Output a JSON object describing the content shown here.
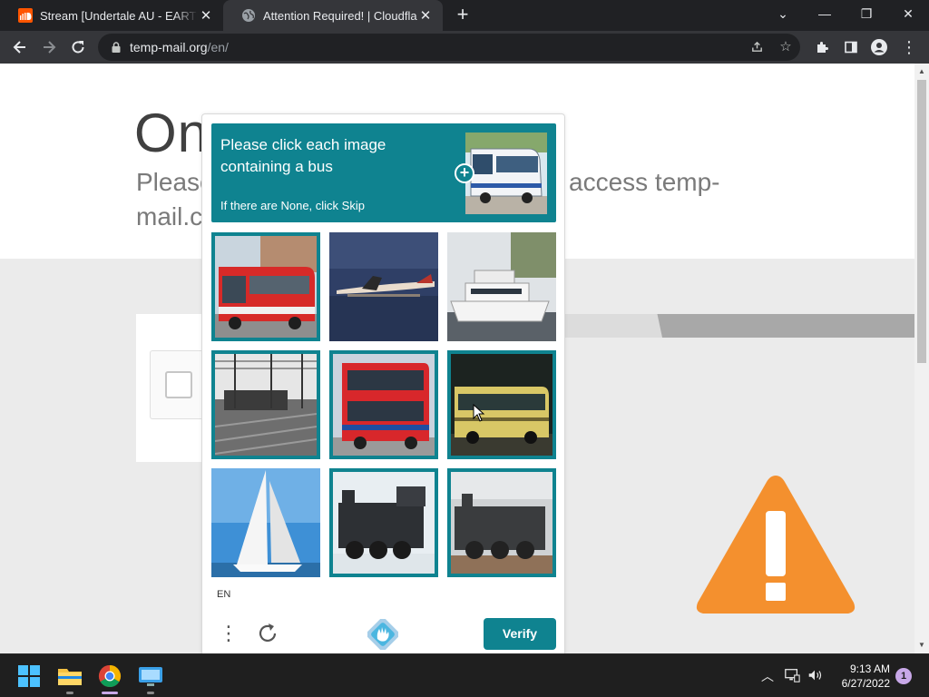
{
  "browser": {
    "tabs": [
      {
        "title": "Stream [Undertale AU - EARTHSE",
        "favicon": "soundcloud-icon",
        "active": false
      },
      {
        "title": "Attention Required! | Cloudflare",
        "favicon": "globe-icon",
        "active": true
      }
    ],
    "new_tab_label": "+",
    "window_controls": {
      "collapse": "⌄",
      "minimize": "—",
      "restore": "❐",
      "close": "✕"
    },
    "url_host": "temp-mail.org",
    "url_path": "/en/",
    "toolbar_icons": [
      "back-icon",
      "forward-icon",
      "reload-icon",
      "share-icon",
      "bookmark-star-icon",
      "extensions-icon",
      "side-panel-icon",
      "profile-icon",
      "menu-icon"
    ]
  },
  "page": {
    "heading_fragment": "On",
    "subtitle_line1_fragment": "Please",
    "subtitle_line2_fragment": "mail.c",
    "subtitle_right_fragment": "access temp-"
  },
  "captcha": {
    "prompt": "Please click each image containing a bus",
    "hint": "If there are None, click Skip",
    "language": "EN",
    "verify_label": "Verify",
    "accent_color": "#0f8390",
    "tiles": [
      {
        "subject": "red-bus",
        "selected": true
      },
      {
        "subject": "seaplane-on-water",
        "selected": false
      },
      {
        "subject": "motor-yacht",
        "selected": false
      },
      {
        "subject": "railway-tracks",
        "selected": true
      },
      {
        "subject": "red-double-decker-bus",
        "selected": true
      },
      {
        "subject": "yellow-bus",
        "selected": true
      },
      {
        "subject": "sailboat",
        "selected": false
      },
      {
        "subject": "steam-locomotive",
        "selected": true
      },
      {
        "subject": "steam-locomotive",
        "selected": true
      }
    ]
  },
  "taskbar": {
    "apps": [
      "start-icon",
      "file-explorer-icon",
      "chrome-icon",
      "remote-desktop-icon"
    ],
    "time": "9:13 AM",
    "date": "6/27/2022",
    "notification_count": "1"
  }
}
